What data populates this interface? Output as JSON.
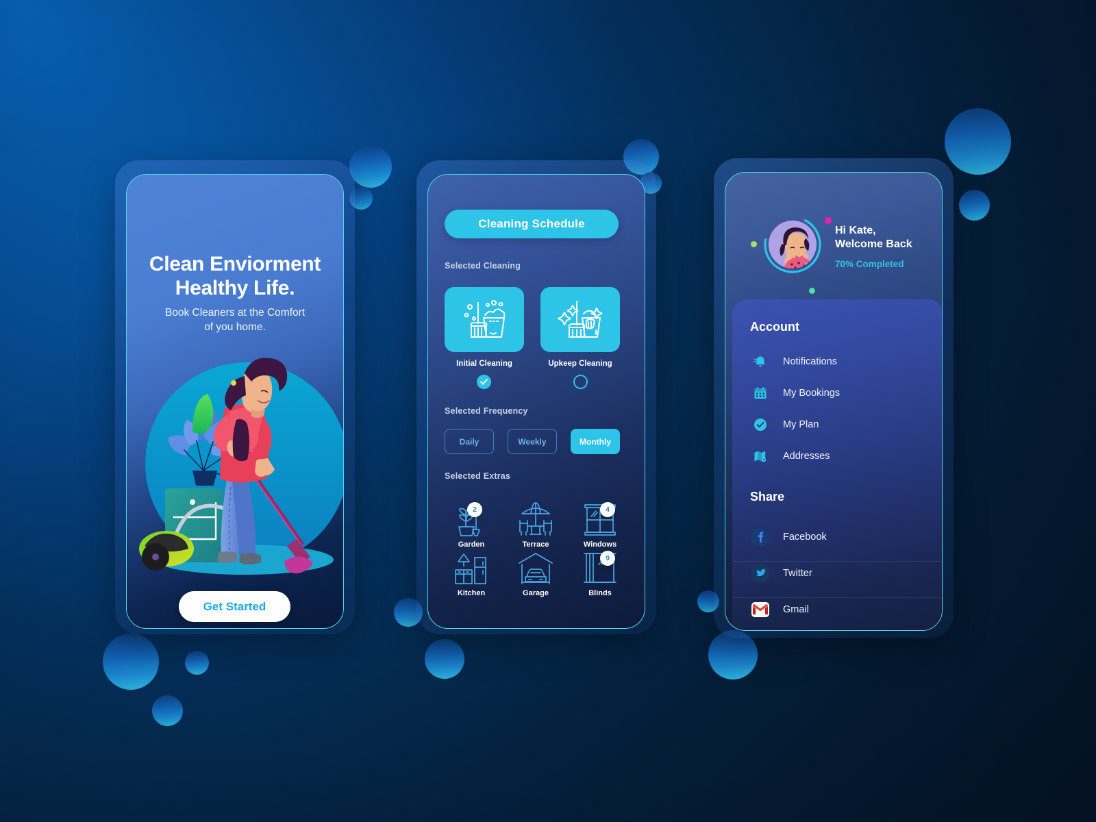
{
  "background": {
    "accent_cyan": "#2ec4e8",
    "deep_navy": "#041324",
    "bright_blue": "#0a74d6"
  },
  "screen_onboarding": {
    "name": "onboarding-screen",
    "title_line1": "Clean Enviorment",
    "title_line2": "Healthy Life.",
    "subtitle_line1": "Book Cleaners at the Comfort",
    "subtitle_line2": "of you home.",
    "cta_label": "Get Started",
    "illustration": "woman-vacuuming-illustration"
  },
  "screen_schedule": {
    "name": "cleaning-schedule-screen",
    "header_label": "Cleaning Schedule",
    "selected_cleaning_label": "Selected Cleaning",
    "cleaning_options": [
      {
        "label": "Initial Cleaning",
        "icon": "broom-bucket-bubbles-icon",
        "selected": true
      },
      {
        "label": "Upkeep Cleaning",
        "icon": "broom-bucket-sparkle-icon",
        "selected": false
      }
    ],
    "selected_frequency_label": "Selected Frequency",
    "frequency_options": [
      {
        "label": "Daily",
        "active": false
      },
      {
        "label": "Weekly",
        "active": false
      },
      {
        "label": "Monthly",
        "active": true
      }
    ],
    "selected_extras_label": "Selected Extras",
    "extras": [
      {
        "label": "Garden",
        "icon": "potted-plant-shovel-icon",
        "badge": "2"
      },
      {
        "label": "Terrace",
        "icon": "patio-umbrella-table-icon",
        "badge": ""
      },
      {
        "label": "Windows",
        "icon": "window-icon",
        "badge": "4"
      },
      {
        "label": "Kitchen",
        "icon": "kitchen-counter-fridge-icon",
        "badge": ""
      },
      {
        "label": "Garage",
        "icon": "garage-car-icon",
        "badge": ""
      },
      {
        "label": "Blinds",
        "icon": "window-blinds-icon",
        "badge": "9"
      }
    ]
  },
  "screen_account": {
    "name": "account-screen",
    "greeting_line1": "Hi Kate,",
    "greeting_line2": "Welcome Back",
    "progress_text": "70% Completed",
    "progress_percent": 70,
    "avatar": "woman-avatar",
    "account_heading": "Account",
    "account_items": [
      {
        "label": "Notifications",
        "icon": "bell-icon"
      },
      {
        "label": "My Bookings",
        "icon": "calendar-icon"
      },
      {
        "label": "My Plan",
        "icon": "check-circle-icon"
      },
      {
        "label": "Addresses",
        "icon": "map-icon"
      }
    ],
    "share_heading": "Share",
    "share_items": [
      {
        "label": "Facebook",
        "icon": "facebook-icon",
        "color": "#1877f2"
      },
      {
        "label": "Twitter",
        "icon": "twitter-icon",
        "color": "#1da1f2"
      },
      {
        "label": "Gmail",
        "icon": "gmail-icon",
        "color": "#ea4335"
      }
    ]
  }
}
